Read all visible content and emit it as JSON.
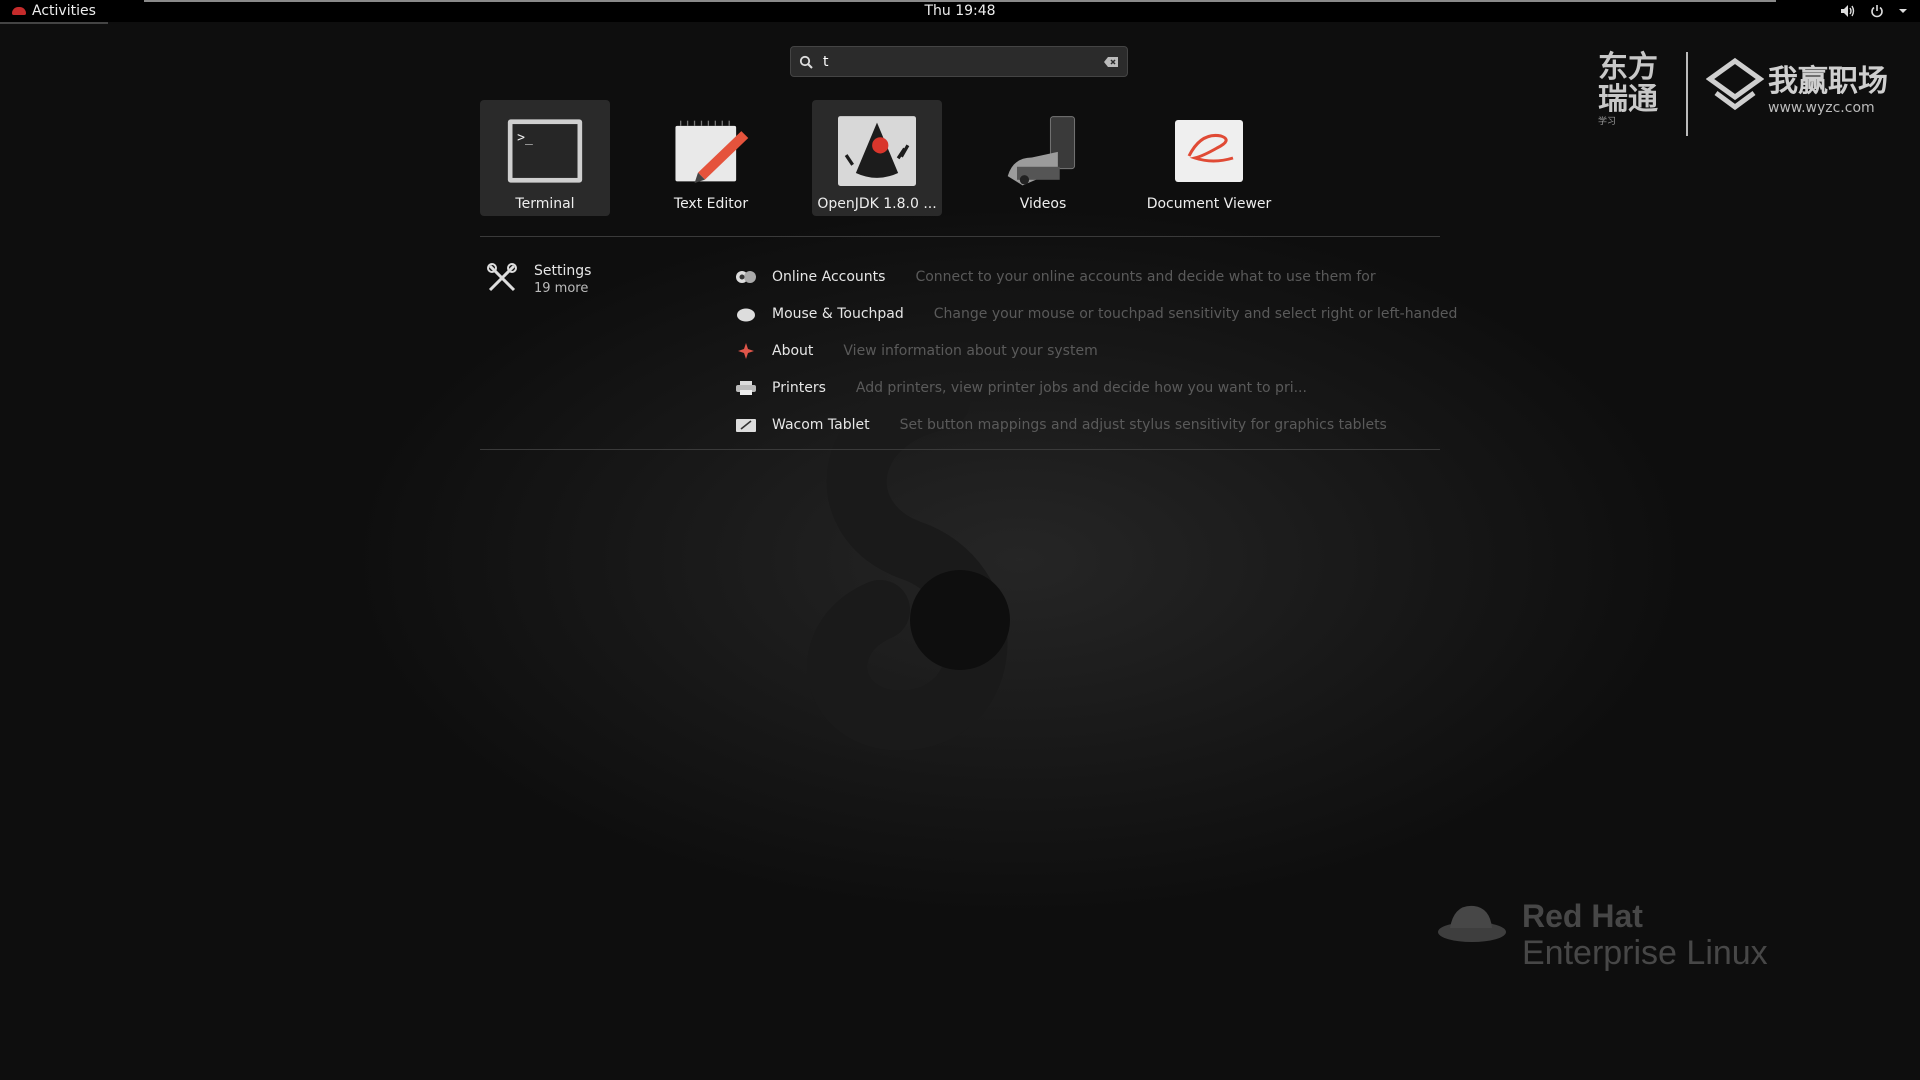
{
  "topbar": {
    "activities_label": "Activities",
    "clock": "Thu 19:48",
    "tray_icons": [
      "volume-icon",
      "power-icon",
      "chevron-down-icon"
    ]
  },
  "search": {
    "value": "t",
    "placeholder": ""
  },
  "apps": [
    {
      "label": "Terminal",
      "icon": "terminal-icon",
      "selected": true
    },
    {
      "label": "Text Editor",
      "icon": "text-editor-icon",
      "selected": false
    },
    {
      "label": "OpenJDK 1.8.0 ...",
      "icon": "java-duke-icon",
      "selected": true
    },
    {
      "label": "Videos",
      "icon": "film-icon",
      "selected": false
    },
    {
      "label": "Document Viewer",
      "icon": "document-viewer-icon",
      "selected": false
    }
  ],
  "settings_provider": {
    "name": "Settings",
    "more": "19 more"
  },
  "settings_results": [
    {
      "name": "Online Accounts",
      "desc": "Connect to your online accounts and decide what to use them for",
      "icon": "online-accounts-icon"
    },
    {
      "name": "Mouse & Touchpad",
      "desc": "Change your mouse or touchpad sensitivity and select right or left-handed",
      "icon": "mouse-icon"
    },
    {
      "name": "About",
      "desc": "View information about your system",
      "icon": "about-star-icon"
    },
    {
      "name": "Printers",
      "desc": "Add printers, view printer jobs and decide how you want to pri...",
      "icon": "printer-icon"
    },
    {
      "name": "Wacom Tablet",
      "desc": "Set button mappings and adjust stylus sensitivity for graphics tablets",
      "icon": "tablet-icon"
    }
  ],
  "watermark": {
    "cn_line1": "东方",
    "cn_line2": "瑞通",
    "cn_small": "学习",
    "brand": "我赢职场",
    "url": "www.wyzc.com"
  },
  "branding": {
    "line1": "Red Hat",
    "line2": "Enterprise Linux"
  }
}
